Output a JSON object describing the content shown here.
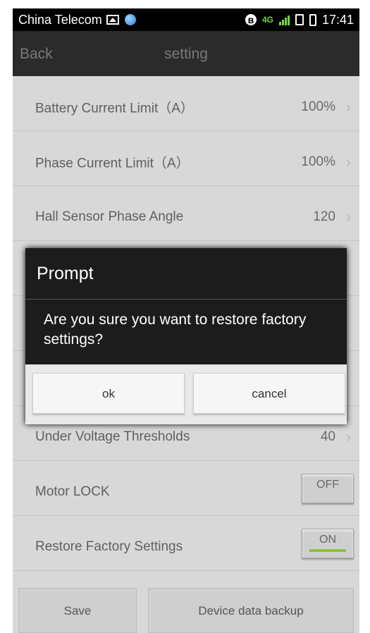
{
  "status_bar": {
    "carrier": "China Telecom",
    "network": "4G",
    "time": "17:41"
  },
  "title_bar": {
    "back_label": "Back",
    "title": "setting"
  },
  "settings": {
    "battery_current_limit": {
      "label": "Battery Current Limit（A）",
      "value": "100%"
    },
    "phase_current_limit": {
      "label": "Phase Current Limit（A）",
      "value": "100%"
    },
    "hall_sensor_phase_angle": {
      "label": "Hall Sensor Phase Angle",
      "value": "120"
    },
    "under_voltage_thresholds": {
      "label": "Under Voltage Thresholds",
      "value": "40"
    },
    "motor_lock": {
      "label": "Motor LOCK",
      "toggle": "OFF"
    },
    "restore_factory_settings": {
      "label": "Restore Factory Settings",
      "toggle": "ON"
    }
  },
  "bottom_buttons": {
    "save": "Save",
    "backup": "Device data backup"
  },
  "dialog": {
    "title": "Prompt",
    "message": "Are you sure you want to restore factory settings?",
    "ok": "ok",
    "cancel": "cancel"
  },
  "colors": {
    "toggle_on_indicator": "#8dbf3d",
    "titlebar": "#2b2b2b"
  }
}
